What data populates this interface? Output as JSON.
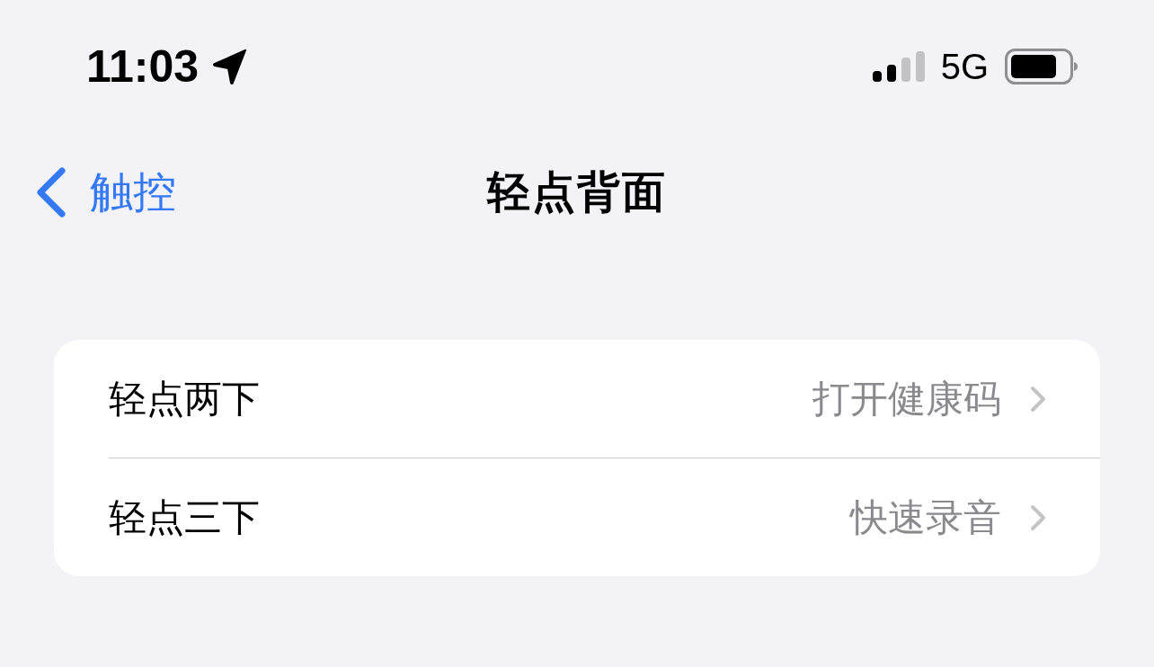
{
  "status_bar": {
    "time": "11:03",
    "network": "5G"
  },
  "nav_bar": {
    "back_label": "触控",
    "title": "轻点背面"
  },
  "settings": [
    {
      "label": "轻点两下",
      "value": "打开健康码"
    },
    {
      "label": "轻点三下",
      "value": "快速录音"
    }
  ]
}
